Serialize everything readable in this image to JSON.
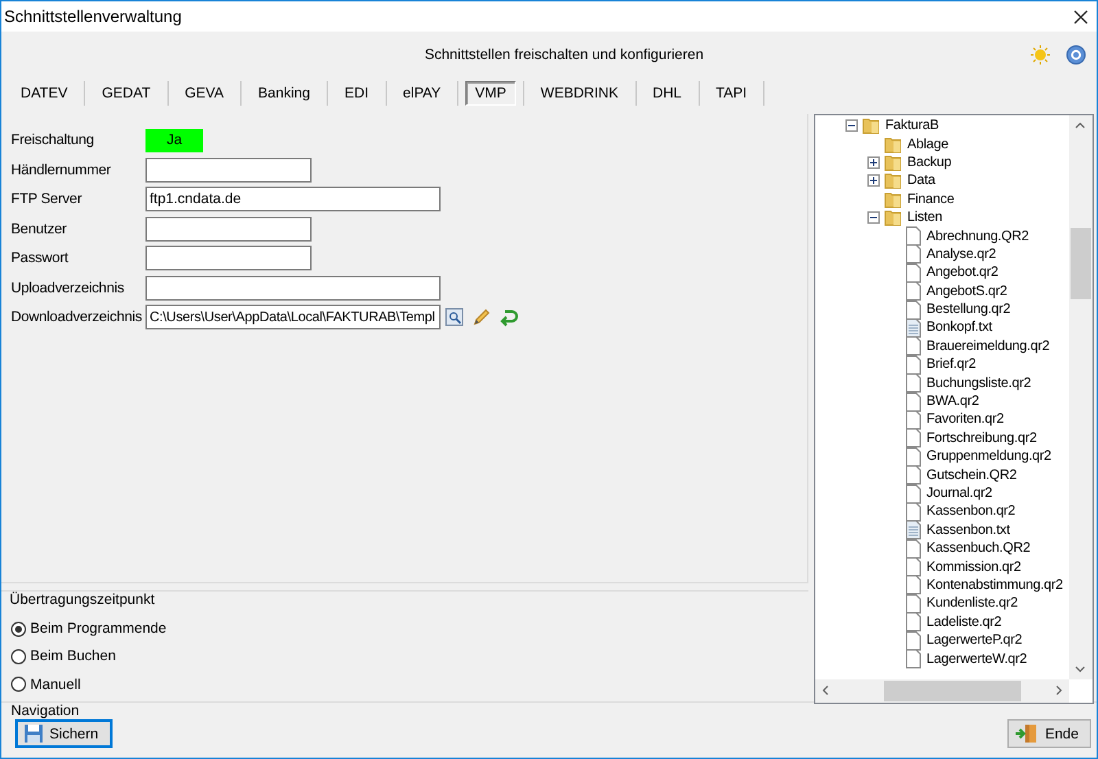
{
  "window": {
    "title": "Schnittstellenverwaltung"
  },
  "header": {
    "subtitle": "Schnittstellen freischalten und konfigurieren"
  },
  "tabs": [
    {
      "label": "DATEV",
      "selected": false
    },
    {
      "label": "GEDAT",
      "selected": false
    },
    {
      "label": "GEVA",
      "selected": false
    },
    {
      "label": "Banking",
      "selected": false
    },
    {
      "label": "EDI",
      "selected": false
    },
    {
      "label": "elPAY",
      "selected": false
    },
    {
      "label": "VMP",
      "selected": true
    },
    {
      "label": "WEBDRINK",
      "selected": false
    },
    {
      "label": "DHL",
      "selected": false
    },
    {
      "label": "TAPI",
      "selected": false
    }
  ],
  "form": {
    "fields": [
      {
        "label": "Freischaltung",
        "kind": "toggle",
        "value": "Ja",
        "on": true
      },
      {
        "label": "Händlernummer",
        "kind": "short"
      },
      {
        "label": "FTP Server",
        "kind": "long",
        "value": "ftp1.cndata.de"
      },
      {
        "label": "Benutzer",
        "kind": "short"
      },
      {
        "label": "Passwort",
        "kind": "short"
      },
      {
        "label": "Uploadverzeichnis",
        "kind": "long"
      },
      {
        "label": "Downloadverzeichnis",
        "kind": "path",
        "value": "C:\\Users\\User\\AppData\\Local\\FAKTURAB\\Templ"
      }
    ]
  },
  "tree": {
    "items": [
      {
        "label": "FakturaB",
        "kind": "folder",
        "expanded": true,
        "children": [
          {
            "label": "Ablage",
            "kind": "folder"
          },
          {
            "label": "Backup",
            "kind": "folder",
            "expanded": false
          },
          {
            "label": "Data",
            "kind": "folder",
            "expanded": false
          },
          {
            "label": "Finance",
            "kind": "folder"
          },
          {
            "label": "Listen",
            "kind": "folder",
            "expanded": true,
            "children": [
              {
                "label": "Abrechnung.QR2",
                "kind": "report"
              },
              {
                "label": "Analyse.qr2",
                "kind": "report"
              },
              {
                "label": "Angebot.qr2",
                "kind": "report"
              },
              {
                "label": "AngebotS.qr2",
                "kind": "report"
              },
              {
                "label": "Bestellung.qr2",
                "kind": "report"
              },
              {
                "label": "Bonkopf.txt",
                "kind": "text"
              },
              {
                "label": "Brauereimeldung.qr2",
                "kind": "report"
              },
              {
                "label": "Brief.qr2",
                "kind": "report"
              },
              {
                "label": "Buchungsliste.qr2",
                "kind": "report"
              },
              {
                "label": "BWA.qr2",
                "kind": "report"
              },
              {
                "label": "Favoriten.qr2",
                "kind": "report"
              },
              {
                "label": "Fortschreibung.qr2",
                "kind": "report"
              },
              {
                "label": "Gruppenmeldung.qr2",
                "kind": "report"
              },
              {
                "label": "Gutschein.QR2",
                "kind": "report"
              },
              {
                "label": "Journal.qr2",
                "kind": "report"
              },
              {
                "label": "Kassenbon.qr2",
                "kind": "report"
              },
              {
                "label": "Kassenbon.txt",
                "kind": "text"
              },
              {
                "label": "Kassenbuch.QR2",
                "kind": "report"
              },
              {
                "label": "Kommission.qr2",
                "kind": "report"
              },
              {
                "label": "Kontenabstimmung.qr2",
                "kind": "report"
              },
              {
                "label": "Kundenliste.qr2",
                "kind": "report"
              },
              {
                "label": "Ladeliste.qr2",
                "kind": "report"
              },
              {
                "label": "LagerwerteP.qr2",
                "kind": "report"
              },
              {
                "label": "LagerwerteW.qr2",
                "kind": "report"
              }
            ]
          }
        ]
      }
    ]
  },
  "transfer": {
    "title": "Übertragungszeitpunkt",
    "options": [
      {
        "label": "Beim Programmende",
        "selected": true
      },
      {
        "label": "Beim Buchen",
        "selected": false
      },
      {
        "label": "Manuell",
        "selected": false
      }
    ]
  },
  "navigation": {
    "title": "Navigation",
    "buttons": [
      {
        "label": "Sichern",
        "kind": "save",
        "focused": true
      },
      {
        "label": "Ende",
        "kind": "exit",
        "focused": false
      }
    ]
  }
}
